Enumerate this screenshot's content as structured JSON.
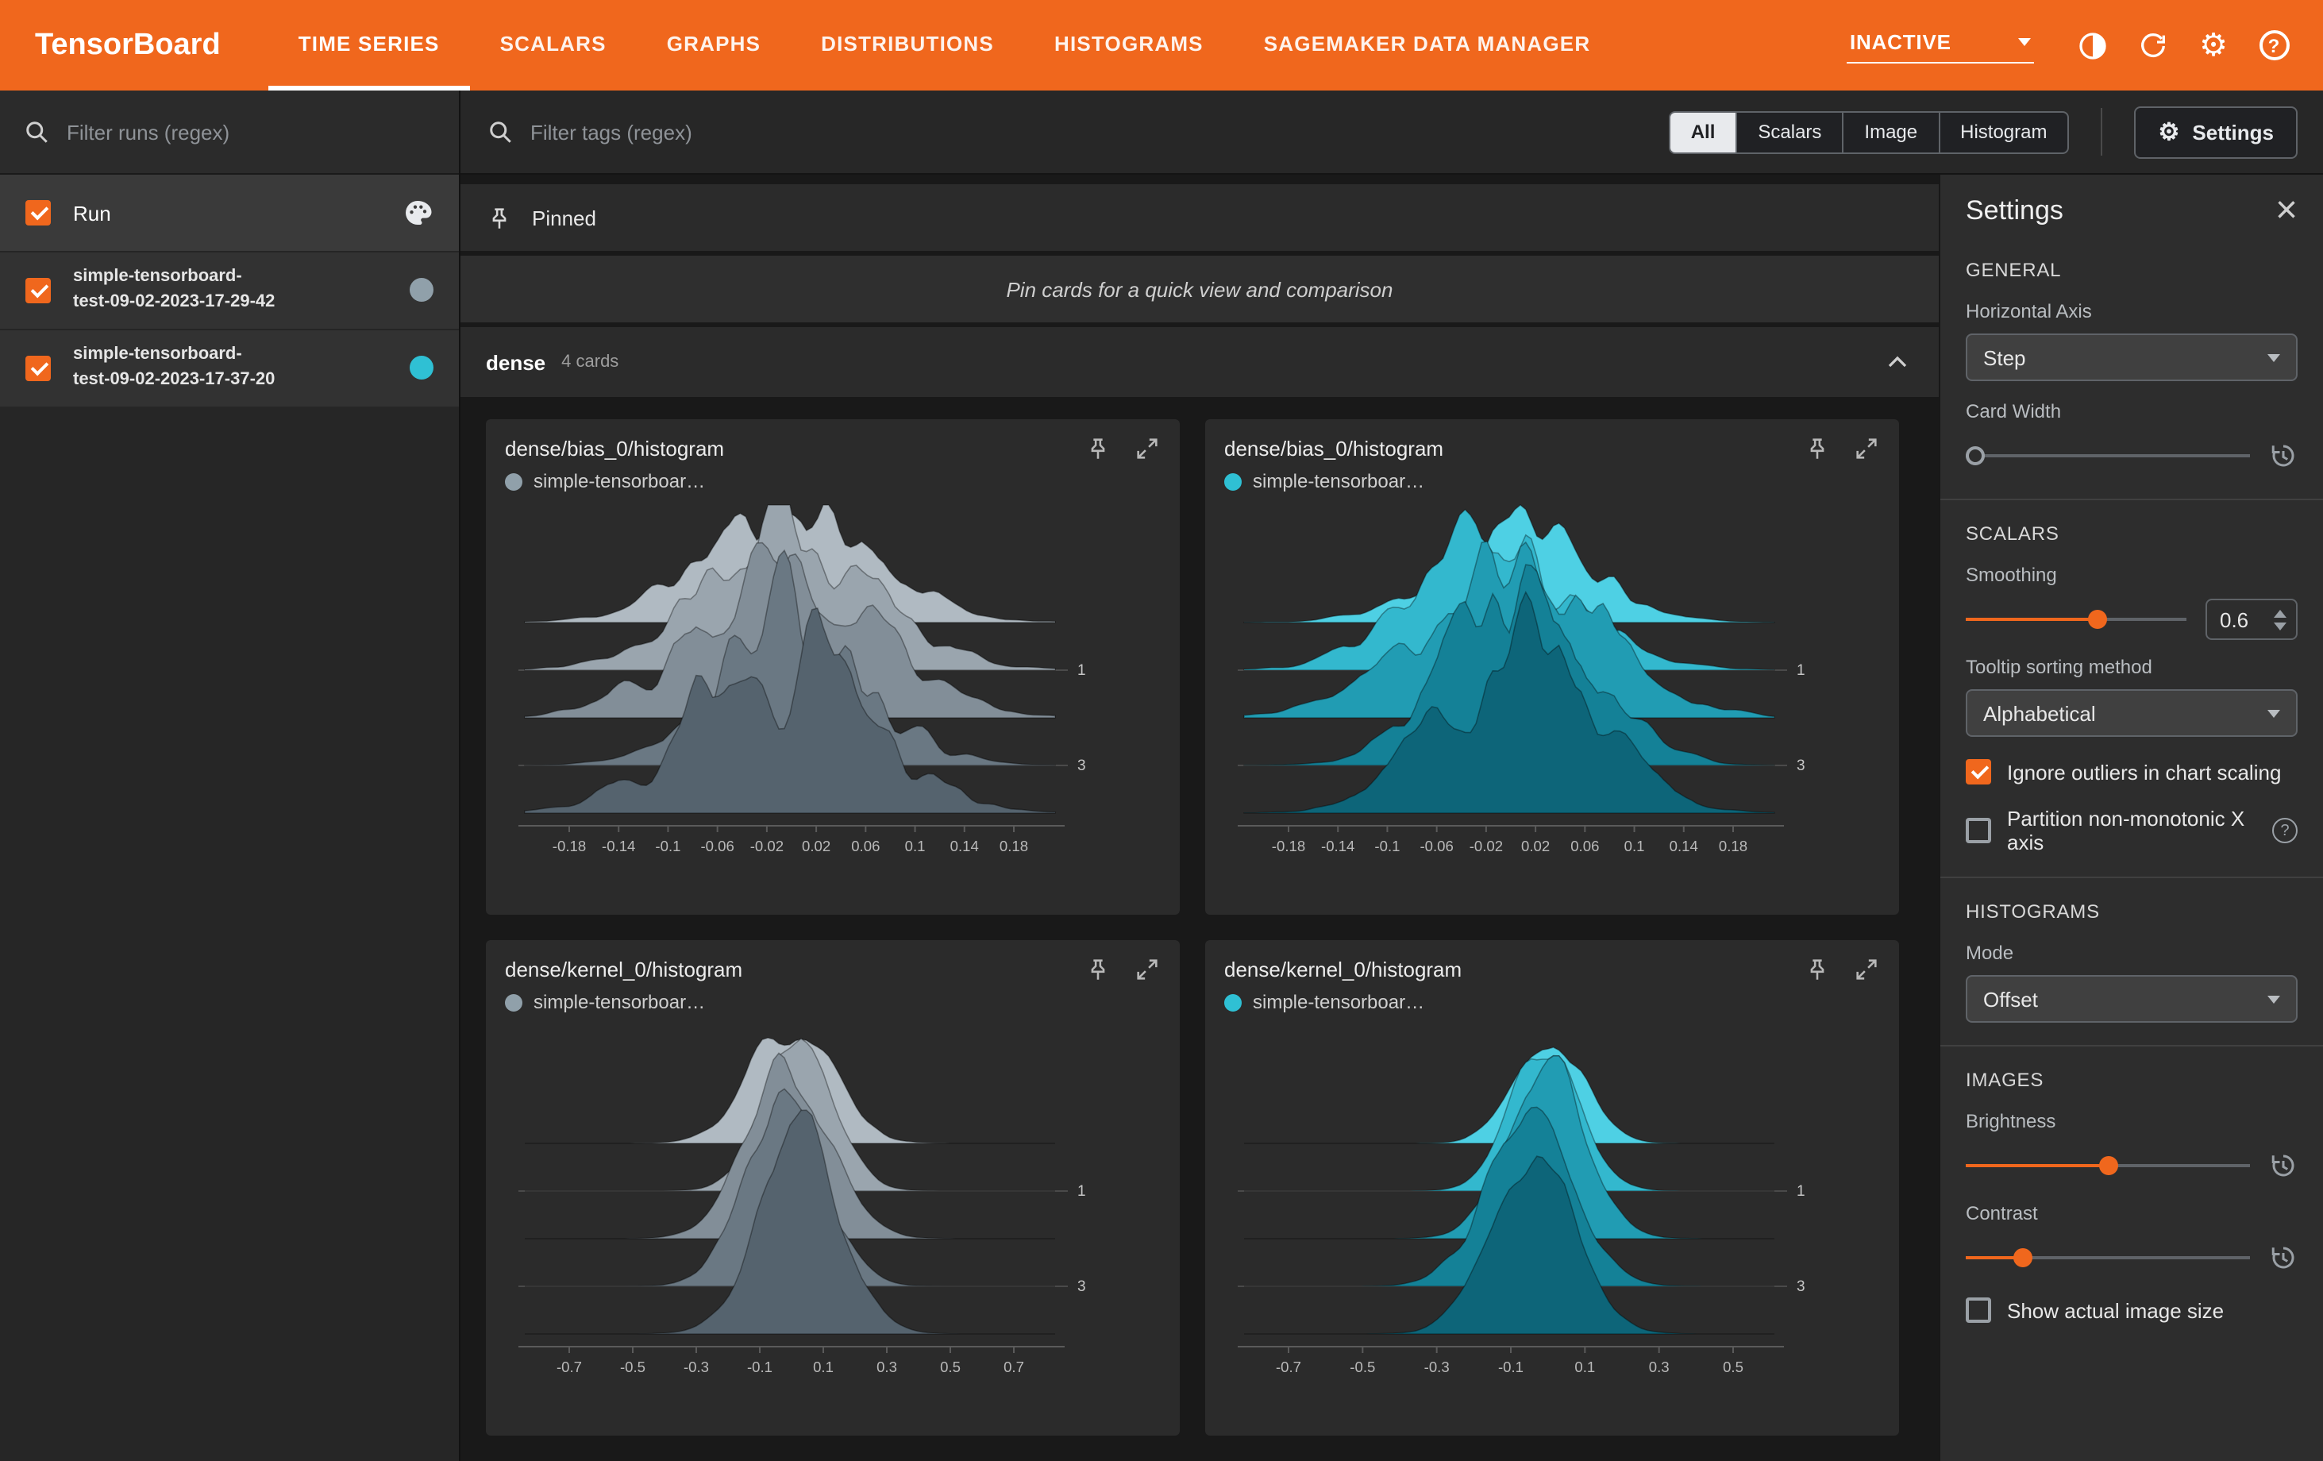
{
  "colors": {
    "accent_orange": "#f0671d",
    "run_gray": "#90a0aa",
    "run_cyan": "#2fc0d4",
    "chip_selected_bg": "#e8eaed"
  },
  "header": {
    "logo": "TensorBoard",
    "tabs": [
      {
        "label": "TIME SERIES",
        "active": true
      },
      {
        "label": "SCALARS",
        "active": false
      },
      {
        "label": "GRAPHS",
        "active": false
      },
      {
        "label": "DISTRIBUTIONS",
        "active": false
      },
      {
        "label": "HISTOGRAMS",
        "active": false
      },
      {
        "label": "SAGEMAKER DATA MANAGER",
        "active": false
      }
    ],
    "status_dropdown": "INACTIVE"
  },
  "sidebar": {
    "filter_placeholder": "Filter runs (regex)",
    "runs_header": {
      "label": "Run",
      "checked": true
    },
    "runs": [
      {
        "name_line1": "simple-tensorboard-",
        "name_line2": "test-09-02-2023-17-29-42",
        "color": "#90a0aa",
        "checked": true
      },
      {
        "name_line1": "simple-tensorboard-",
        "name_line2": "test-09-02-2023-17-37-20",
        "color": "#2fc0d4",
        "checked": true
      }
    ]
  },
  "toolbar": {
    "filter_placeholder": "Filter tags (regex)",
    "chips": [
      {
        "label": "All",
        "selected": true
      },
      {
        "label": "Scalars",
        "selected": false
      },
      {
        "label": "Image",
        "selected": false
      },
      {
        "label": "Histogram",
        "selected": false
      }
    ],
    "settings_button": "Settings"
  },
  "main": {
    "pinned_label": "Pinned",
    "pinned_empty": "Pin cards for a quick view and comparison",
    "section": {
      "name": "dense",
      "count": "4 cards"
    }
  },
  "histogram_palettes": {
    "gray": [
      "#b0bac2",
      "#9aa5ae",
      "#828e98",
      "#6a7883",
      "#55636e"
    ],
    "cyan": [
      "#4ed0e4",
      "#33b8ce",
      "#219cb3",
      "#148197",
      "#0d6579"
    ]
  },
  "cards": [
    {
      "title": "dense/bias_0/histogram",
      "run": "simple-tensorboar…",
      "run_color": "#90a0aa",
      "palette": "gray",
      "x_ticks": [
        "-0.18",
        "-0.14",
        "-0.1",
        "-0.06",
        "-0.02",
        "0.02",
        "0.06",
        "0.1",
        "0.14",
        "0.18"
      ],
      "y_ticks": [
        {
          "label": "1",
          "layer": 1
        },
        {
          "label": "3",
          "layer": 3
        }
      ],
      "shape": {
        "mu": 0.5,
        "sigma": 0.155,
        "rough": 0.3,
        "seed": 11
      }
    },
    {
      "title": "dense/bias_0/histogram",
      "run": "simple-tensorboar…",
      "run_color": "#2fc0d4",
      "palette": "cyan",
      "x_ticks": [
        "-0.18",
        "-0.14",
        "-0.1",
        "-0.06",
        "-0.02",
        "0.02",
        "0.06",
        "0.1",
        "0.14",
        "0.18"
      ],
      "y_ticks": [
        {
          "label": "1",
          "layer": 1
        },
        {
          "label": "3",
          "layer": 3
        }
      ],
      "shape": {
        "mu": 0.5,
        "sigma": 0.15,
        "rough": 0.3,
        "seed": 22
      }
    },
    {
      "title": "dense/kernel_0/histogram",
      "run": "simple-tensorboar…",
      "run_color": "#90a0aa",
      "palette": "gray",
      "x_ticks": [
        "-0.7",
        "-0.5",
        "-0.3",
        "-0.1",
        "0.1",
        "0.3",
        "0.5",
        "0.7"
      ],
      "y_ticks": [
        {
          "label": "1",
          "layer": 1
        },
        {
          "label": "3",
          "layer": 3
        }
      ],
      "shape": {
        "mu": 0.5,
        "sigma": 0.072,
        "rough": 0.13,
        "seed": 33
      }
    },
    {
      "title": "dense/kernel_0/histogram",
      "run": "simple-tensorboar…",
      "run_color": "#2fc0d4",
      "palette": "cyan",
      "x_ticks": [
        "-0.7",
        "-0.5",
        "-0.3",
        "-0.1",
        "0.1",
        "0.3",
        "0.5"
      ],
      "y_ticks": [
        {
          "label": "1",
          "layer": 1
        },
        {
          "label": "3",
          "layer": 3
        }
      ],
      "shape": {
        "mu": 0.56,
        "sigma": 0.072,
        "rough": 0.13,
        "seed": 44
      }
    }
  ],
  "settings_panel": {
    "title": "Settings",
    "general": {
      "heading": "GENERAL",
      "horizontal_axis_label": "Horizontal Axis",
      "horizontal_axis_value": "Step",
      "card_width_label": "Card Width",
      "card_width_pct": 0
    },
    "scalars": {
      "heading": "SCALARS",
      "smoothing_label": "Smoothing",
      "smoothing_value": "0.6",
      "smoothing_pct": 60,
      "tooltip_sorting_label": "Tooltip sorting method",
      "tooltip_sorting_value": "Alphabetical",
      "ignore_outliers_label": "Ignore outliers in chart scaling",
      "ignore_outliers_checked": true,
      "partition_label": "Partition non-monotonic X axis",
      "partition_checked": false
    },
    "histograms": {
      "heading": "HISTOGRAMS",
      "mode_label": "Mode",
      "mode_value": "Offset"
    },
    "images": {
      "heading": "IMAGES",
      "brightness_label": "Brightness",
      "brightness_pct": 50,
      "contrast_label": "Contrast",
      "contrast_pct": 20,
      "show_actual_size_label": "Show actual image size",
      "show_actual_size_checked": false
    }
  },
  "chart_data": [
    {
      "type": "area",
      "subtype": "ridgeline-histogram-offset",
      "title": "dense/bias_0/histogram",
      "run": "simple-tensorboard-test-09-02-2023-17-29-42",
      "x_ticks": [
        -0.18,
        -0.14,
        -0.1,
        -0.06,
        -0.02,
        0.02,
        0.06,
        0.1,
        0.14,
        0.18
      ],
      "step_axis_labels": [
        1,
        3
      ],
      "layers": 5,
      "approx_center": 0,
      "approx_half_width": 0.1
    },
    {
      "type": "area",
      "subtype": "ridgeline-histogram-offset",
      "title": "dense/bias_0/histogram",
      "run": "simple-tensorboard-test-09-02-2023-17-37-20",
      "x_ticks": [
        -0.18,
        -0.14,
        -0.1,
        -0.06,
        -0.02,
        0.02,
        0.06,
        0.1,
        0.14,
        0.18
      ],
      "step_axis_labels": [
        1,
        3
      ],
      "layers": 5,
      "approx_center": 0,
      "approx_half_width": 0.1
    },
    {
      "type": "area",
      "subtype": "ridgeline-histogram-offset",
      "title": "dense/kernel_0/histogram",
      "run": "simple-tensorboard-test-09-02-2023-17-29-42",
      "x_ticks": [
        -0.7,
        -0.5,
        -0.3,
        -0.1,
        0.1,
        0.3,
        0.5,
        0.7
      ],
      "step_axis_labels": [
        1,
        3
      ],
      "layers": 5,
      "approx_center": 0,
      "approx_half_width": 0.15
    },
    {
      "type": "area",
      "subtype": "ridgeline-histogram-offset",
      "title": "dense/kernel_0/histogram",
      "run": "simple-tensorboard-test-09-02-2023-17-37-20",
      "x_ticks": [
        -0.7,
        -0.5,
        -0.3,
        -0.1,
        0.1,
        0.3,
        0.5
      ],
      "step_axis_labels": [
        1,
        3
      ],
      "layers": 5,
      "approx_center": 0,
      "approx_half_width": 0.15
    }
  ]
}
